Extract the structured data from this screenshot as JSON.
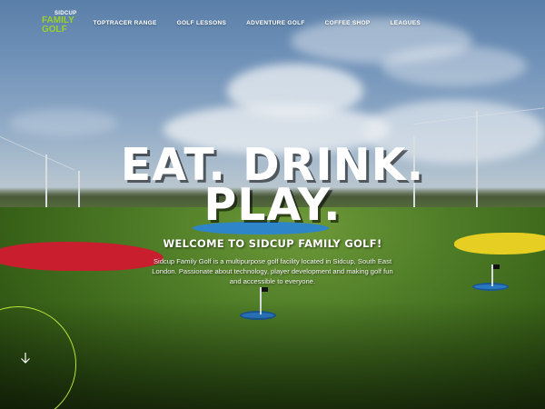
{
  "logo": {
    "line1": "SIDCUP",
    "line2": "FAMILY",
    "line3": "GOLF"
  },
  "nav": {
    "items": [
      {
        "label": "TOPTRACER RANGE"
      },
      {
        "label": "GOLF LESSONS"
      },
      {
        "label": "ADVENTURE GOLF"
      },
      {
        "label": "COFFEE SHOP"
      },
      {
        "label": "LEAGUES"
      }
    ]
  },
  "hero": {
    "headline_line1": "EAT. DRINK.",
    "headline_line2": "PLAY.",
    "welcome": "WELCOME TO SIDCUP FAMILY GOLF!",
    "description": "Sidcup Family Golf is a multipurpose golf facility located in Sidcup, South East London. Passionate about technology, player development and making golf fun and accessible to everyone."
  },
  "scroll": {
    "icon": "arrow-down-icon"
  },
  "colors": {
    "accent": "#9ad12a",
    "ring": "#b8e33a",
    "red_green": "#c81e2e",
    "yellow_green": "#e6cf22",
    "blue_target": "#2a78c2"
  }
}
